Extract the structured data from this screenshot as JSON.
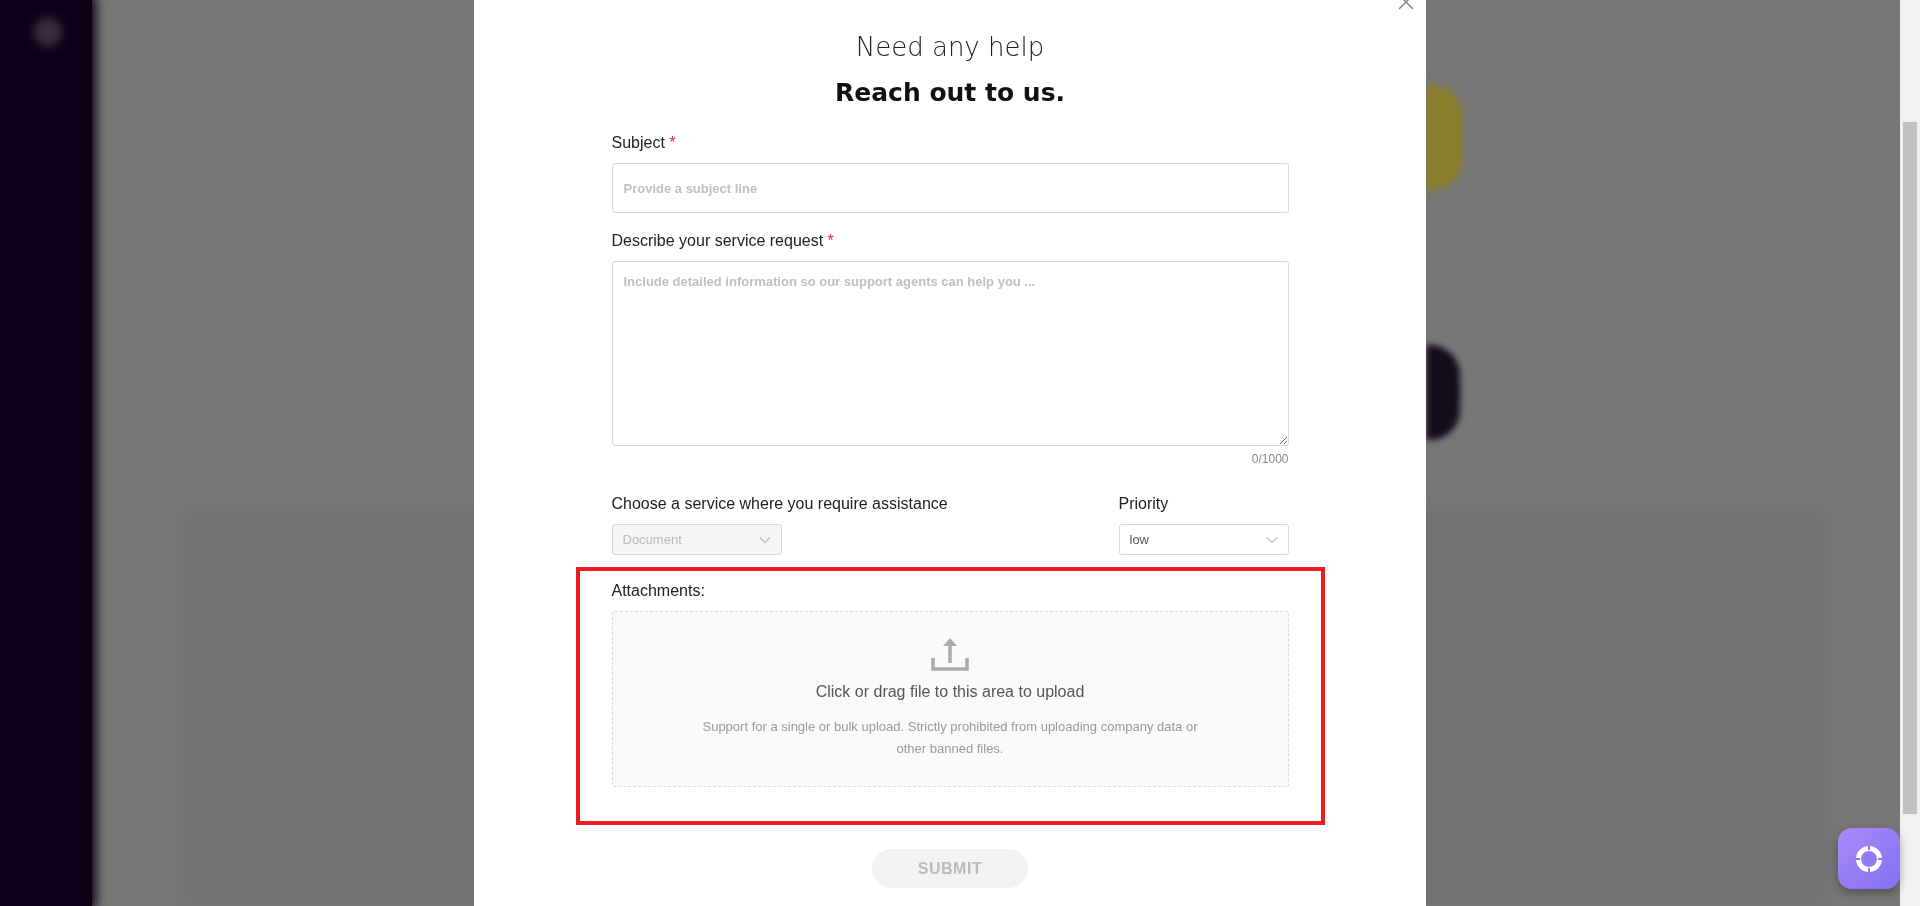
{
  "dialog": {
    "heading": "Need any help",
    "subheading": "Reach out to us.",
    "fields": [
      {
        "kind": "input",
        "label": "Subject",
        "required_mark": "*",
        "placeholder": "Provide a subject line"
      },
      {
        "kind": "textarea",
        "label": "Describe your service request",
        "required_mark": "*",
        "placeholder": "Include detailed information so our support agents can help you ...",
        "counter": "0/1000"
      }
    ],
    "selects": [
      {
        "label": "Choose a service where you require assistance",
        "value": "Document",
        "disabled": true
      },
      {
        "label": "Priority",
        "value": "low",
        "disabled": false
      }
    ],
    "attachments": {
      "label": "Attachments:",
      "highlighted": true,
      "title": "Click or drag file to this area to upload",
      "hint": "Support for a single or bulk upload. Strictly prohibited from uploading company data or other banned files."
    },
    "submit": {
      "label": "SUBMIT",
      "disabled": true
    }
  }
}
